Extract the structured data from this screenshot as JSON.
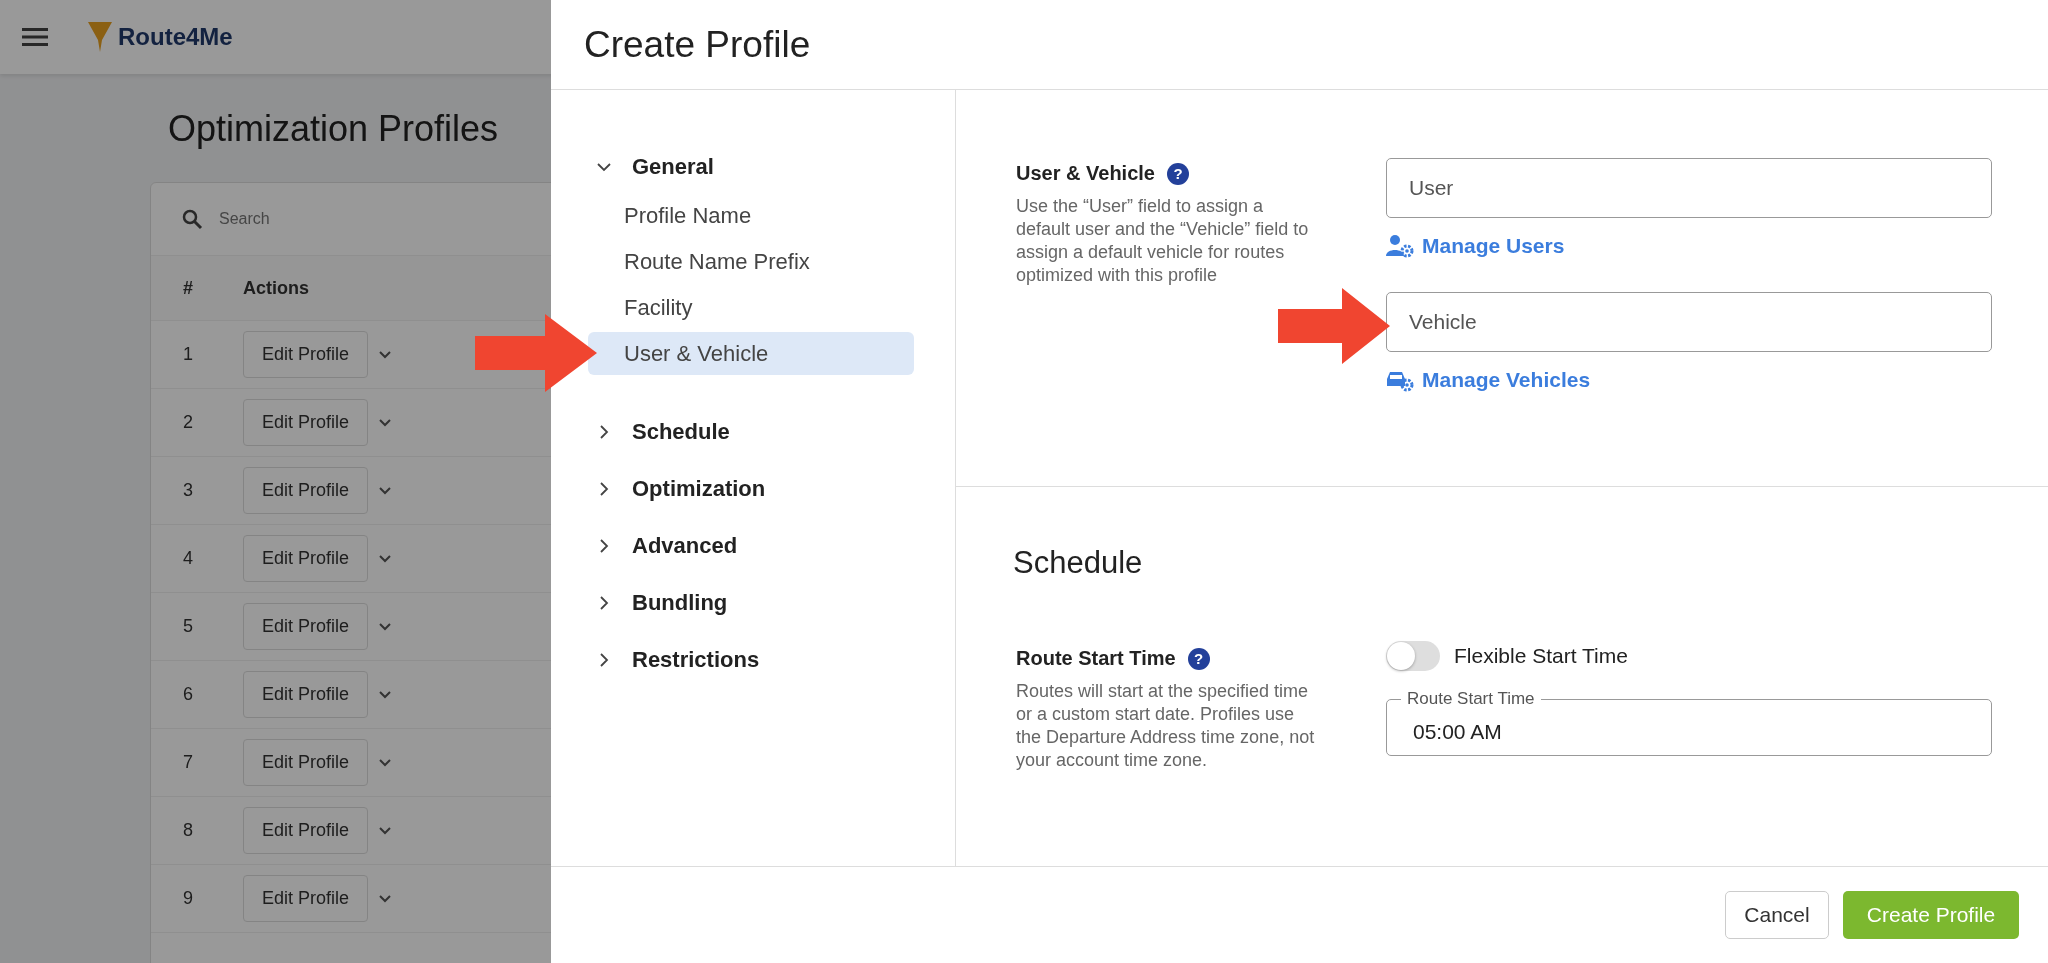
{
  "background_page": {
    "logo": "Route4Me",
    "title": "Optimization Profiles",
    "search": {
      "placeholder": "Search"
    },
    "table": {
      "columns": [
        "#",
        "Actions"
      ],
      "rows": [
        {
          "number": "1",
          "action": "Edit Profile"
        },
        {
          "number": "2",
          "action": "Edit Profile"
        },
        {
          "number": "3",
          "action": "Edit Profile"
        },
        {
          "number": "4",
          "action": "Edit Profile"
        },
        {
          "number": "5",
          "action": "Edit Profile"
        },
        {
          "number": "6",
          "action": "Edit Profile"
        },
        {
          "number": "7",
          "action": "Edit Profile"
        },
        {
          "number": "8",
          "action": "Edit Profile"
        },
        {
          "number": "9",
          "action": "Edit Profile"
        }
      ]
    }
  },
  "dialog": {
    "title": "Create Profile",
    "nav": [
      {
        "label": "General",
        "expanded": true,
        "children": [
          {
            "label": "Profile Name",
            "selected": false
          },
          {
            "label": "Route Name Prefix",
            "selected": false
          },
          {
            "label": "Facility",
            "selected": false
          },
          {
            "label": "User & Vehicle",
            "selected": true
          }
        ]
      },
      {
        "label": "Schedule",
        "expanded": false
      },
      {
        "label": "Optimization",
        "expanded": false
      },
      {
        "label": "Advanced",
        "expanded": false
      },
      {
        "label": "Bundling",
        "expanded": false
      },
      {
        "label": "Restrictions",
        "expanded": false
      }
    ],
    "user_vehicle": {
      "label": "User & Vehicle",
      "help_icon": "?",
      "description": "Use the “User” field to assign a default user and the “Vehicle” field to assign a default vehicle for routes optimized with this profile",
      "user_field": {
        "placeholder": "User"
      },
      "users_link": "Manage Users",
      "vehicle_field": {
        "placeholder": "Vehicle"
      },
      "vehicles_link": "Manage Vehicles"
    },
    "schedule": {
      "heading": "Schedule",
      "label": "Route Start Time",
      "help_icon": "?",
      "description": "Routes will start at the specified time or a custom start date. Profiles use the Departure Address time zone, not your account time zone.",
      "toggle": {
        "label": "Flexible Start Time",
        "on": false
      },
      "time_field": {
        "label": "Route Start Time",
        "value": "05:00 AM"
      }
    },
    "buttons": [
      {
        "label": "Cancel",
        "kind": "secondary"
      },
      {
        "label": "Create Profile",
        "kind": "primary"
      }
    ]
  }
}
